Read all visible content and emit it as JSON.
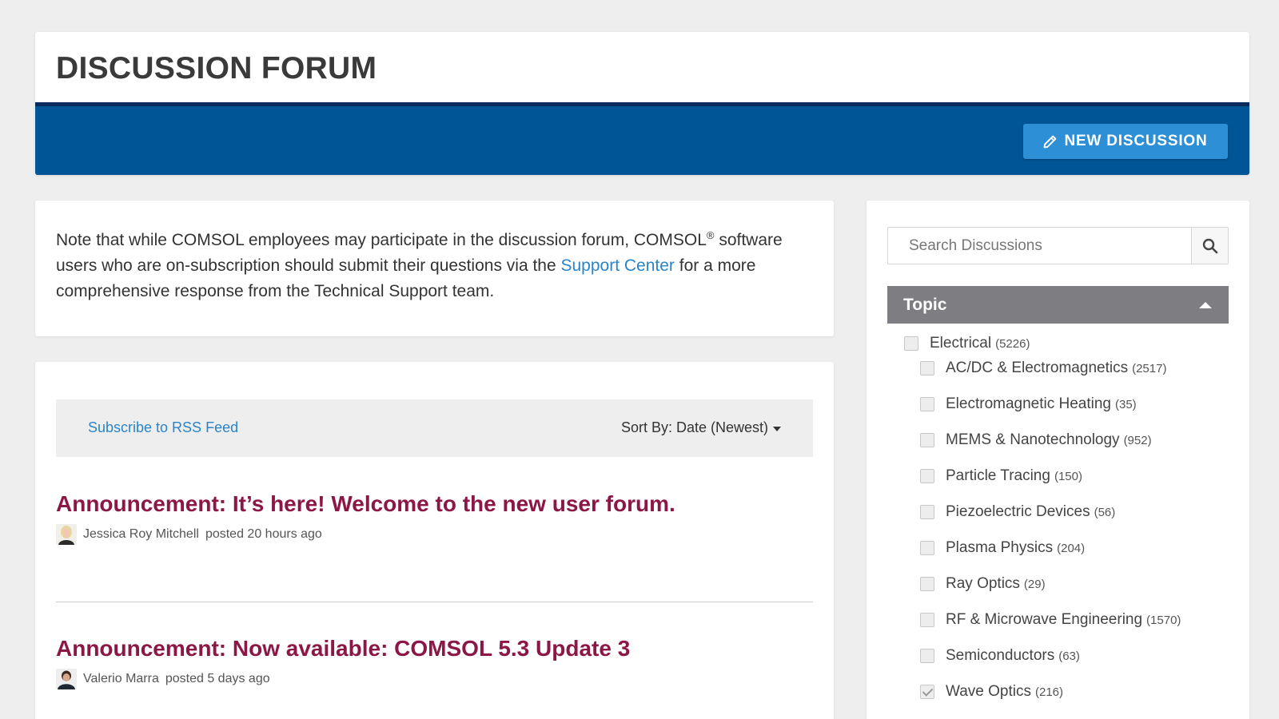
{
  "header": {
    "title": "DISCUSSION FORUM",
    "new_discussion_label": "NEW DISCUSSION",
    "bar_color": "#005597",
    "button_color": "#2d8fd5"
  },
  "note": {
    "text_before": "Note that while COMSOL employees may participate in the discussion forum, COMSOL",
    "registered": "®",
    "text_middle": " software users who are on-subscription should submit their questions via the ",
    "link_label": "Support Center",
    "text_after": " for a more comprehensive response from the Technical Support team."
  },
  "toolbar": {
    "rss_label": "Subscribe to RSS Feed",
    "sort_label": "Sort By: Date (Newest)"
  },
  "posts": [
    {
      "title": "Announcement: It’s here! Welcome to the new user forum.",
      "author": "Jessica Roy Mitchell",
      "meta": "posted 20 hours ago"
    },
    {
      "title": "Announcement: Now available: COMSOL 5.3 Update 3",
      "author": "Valerio Marra",
      "meta": "posted 5 days ago"
    }
  ],
  "sidebar": {
    "search_placeholder": "Search Discussions",
    "topic_header": "Topic",
    "topics": [
      {
        "label": "Electrical",
        "count": "(5226)",
        "checked": false
      },
      {
        "label": "AC/DC & Electromagnetics",
        "count": "(2517)",
        "checked": false
      },
      {
        "label": "Electromagnetic Heating",
        "count": "(35)",
        "checked": false
      },
      {
        "label": "MEMS & Nanotechnology",
        "count": "(952)",
        "checked": false
      },
      {
        "label": "Particle Tracing",
        "count": "(150)",
        "checked": false
      },
      {
        "label": "Piezoelectric Devices",
        "count": "(56)",
        "checked": false
      },
      {
        "label": "Plasma Physics",
        "count": "(204)",
        "checked": false
      },
      {
        "label": "Ray Optics",
        "count": "(29)",
        "checked": false
      },
      {
        "label": "RF & Microwave Engineering",
        "count": "(1570)",
        "checked": false
      },
      {
        "label": "Semiconductors",
        "count": "(63)",
        "checked": false
      },
      {
        "label": "Wave Optics",
        "count": "(216)",
        "checked": true
      }
    ]
  },
  "colors": {
    "post_title": "#8c1746",
    "link": "#2a84c8",
    "topic_header_bg": "#7e7d82"
  }
}
